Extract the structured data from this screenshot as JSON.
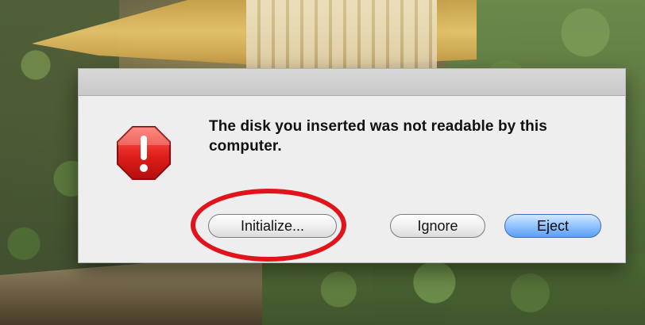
{
  "dialog": {
    "message": "The disk you inserted was not readable by this computer.",
    "buttons": {
      "initialize": "Initialize...",
      "ignore": "Ignore",
      "eject": "Eject"
    },
    "icon": "stop-alert-icon",
    "default_button": "eject"
  },
  "annotation": {
    "highlight_color": "#e1141b",
    "highlight_target": "initialize-button"
  },
  "colors": {
    "dialog_bg": "#eeeeee",
    "alert_red": "#d31b1b",
    "primary_button": "#5b9ff4"
  }
}
